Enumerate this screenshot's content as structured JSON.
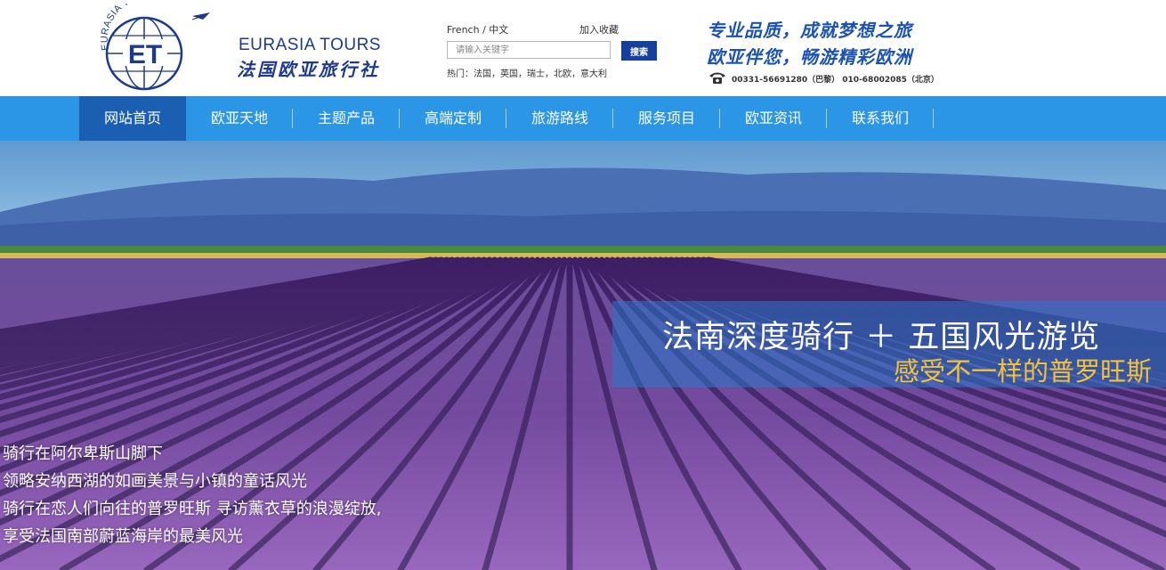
{
  "logo": {
    "globe_text": "ET",
    "arc_text": "EURASIA TOURS",
    "name_en": "EURASIA TOURS",
    "name_cn": "法国欧亚旅行社"
  },
  "top": {
    "language": "French / 中文",
    "bookmark": "加入收藏"
  },
  "search": {
    "placeholder": "请输入关键字",
    "button": "搜索",
    "hot": "热门：法国，英国，瑞士，北欧，意大利"
  },
  "slogan": {
    "line1": "专业品质，成就梦想之旅",
    "line2": "欧亚伴您，畅游精彩欧洲",
    "phone": "00331-56691280（巴黎） 010-68002085（北京）",
    "phone_icon": "telephone-icon"
  },
  "nav": {
    "items": [
      {
        "label": "网站首页"
      },
      {
        "label": "欧亚天地"
      },
      {
        "label": "主题产品"
      },
      {
        "label": "高端定制"
      },
      {
        "label": "旅游路线"
      },
      {
        "label": "服务项目"
      },
      {
        "label": "欧亚资讯"
      },
      {
        "label": "联系我们"
      }
    ],
    "active_index": 0
  },
  "banner": {
    "title": "法南深度骑行 ＋ 五国风光游览",
    "subtitle": "感受不一样的普罗旺斯",
    "lines": [
      "骑行在阿尔卑斯山脚下",
      "领略安纳西湖的如画美景与小镇的童话风光",
      "骑行在恋人们向往的普罗旺斯 寻访薰衣草的浪漫绽放,",
      "享受法国南部蔚蓝海岸的最美风光"
    ]
  },
  "colors": {
    "nav": "#2b95e6",
    "nav_active": "#1b5fb3",
    "brand_blue": "#1d3a8e",
    "search_button": "#173f9c",
    "caption_accent": "#f2c23a"
  }
}
